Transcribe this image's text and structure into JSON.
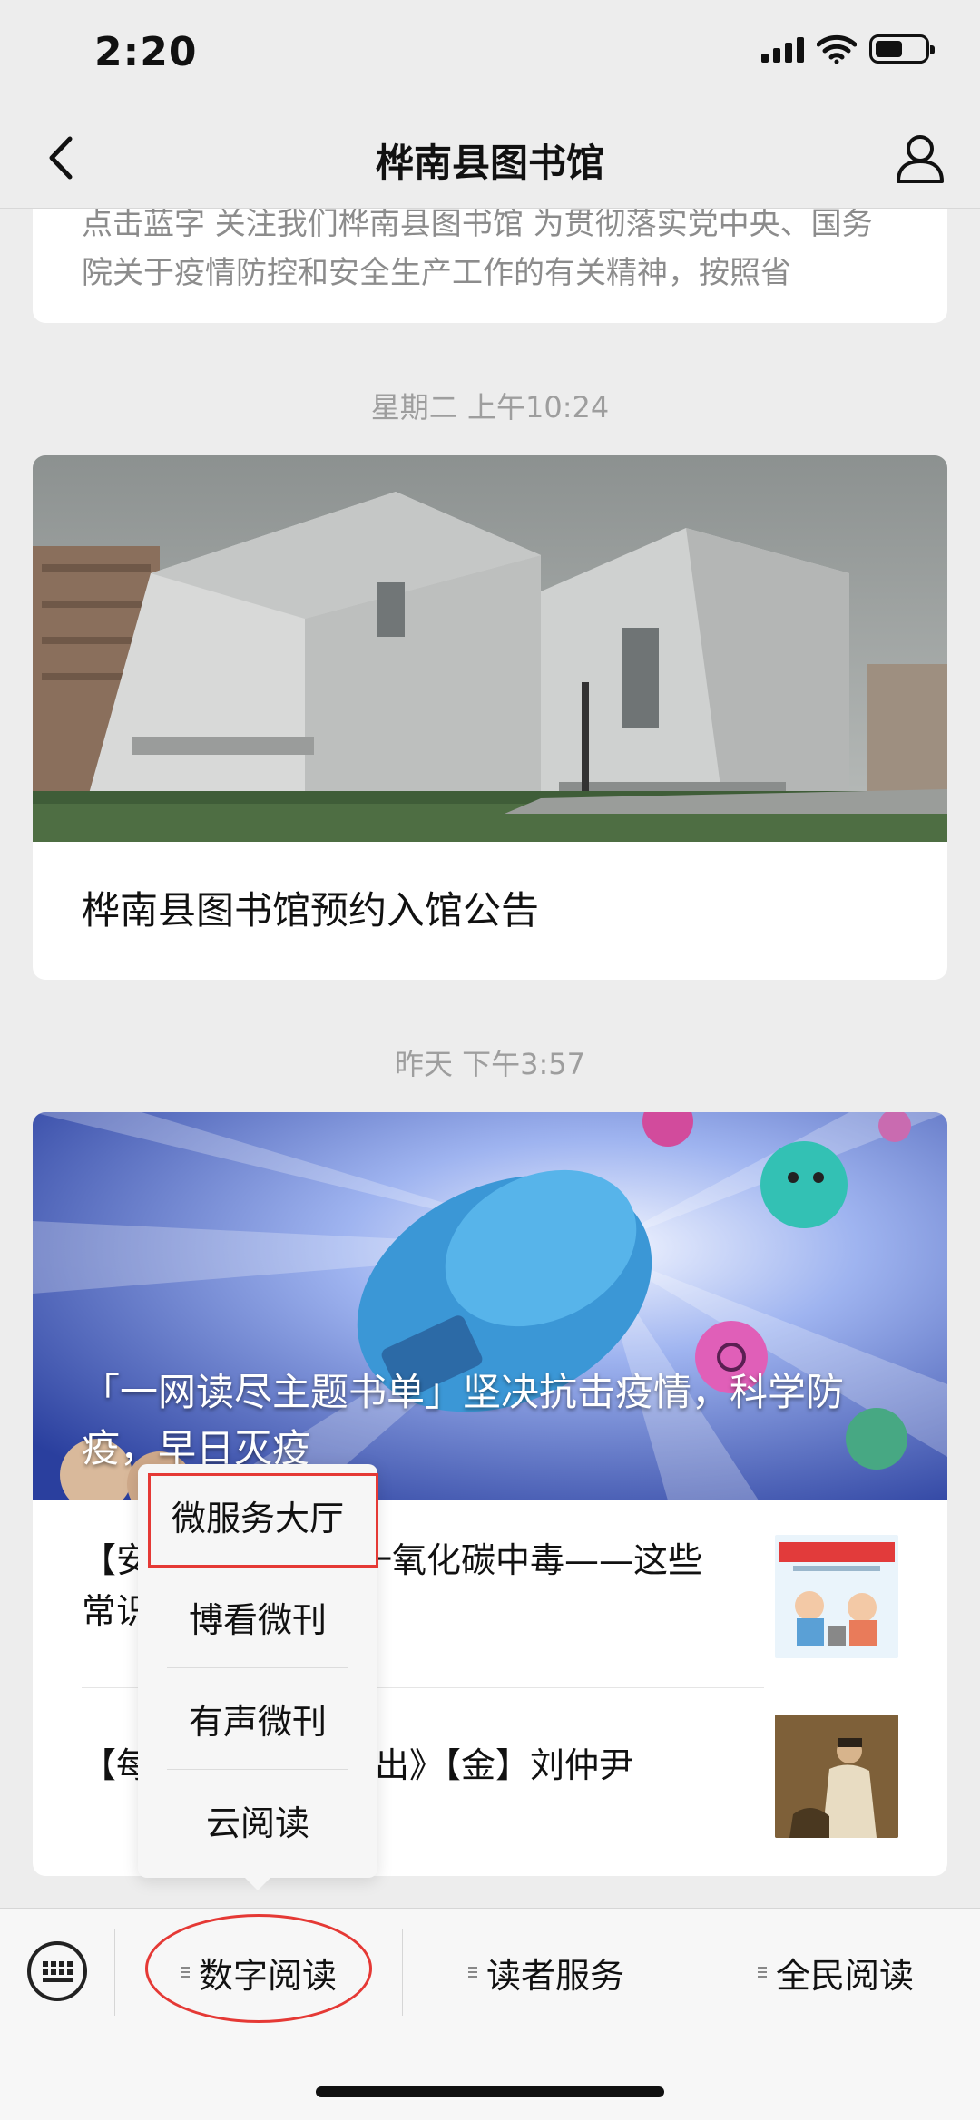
{
  "status_bar": {
    "time": "2:20",
    "icons": [
      "signal-icon",
      "wifi-icon",
      "battery-icon"
    ]
  },
  "nav": {
    "back_icon": "chevron-left-icon",
    "title": "桦南县图书馆",
    "profile_icon": "person-icon"
  },
  "feed": {
    "first_card_snippet": "点击蓝字 关注我们桦南县图书馆 为贯彻落实党中央、国务院关于疫情防控和安全生产工作的有关精神，按照省",
    "ts1": "星期二 上午10:24",
    "announcement_title": "桦南县图书馆预约入馆公告",
    "ts2": "昨天 下午3:57",
    "banner_title": "「一网读尽主题书单」坚决抗击疫情，科学防疫，早日灭疫",
    "articles": [
      {
        "title": "【安全知识】预防一氧化碳中毒——这些常识您要知道！",
        "thumb_icon": "co-poison-poster-thumb"
      },
      {
        "title": "【每日一诗】《秋日出》【金】刘仲尹",
        "thumb_icon": "painting-thumb"
      }
    ]
  },
  "popup_menu": {
    "items": [
      "微服务大厅",
      "博看微刊",
      "有声微刊",
      "云阅读"
    ]
  },
  "bottom_menu": {
    "keyboard_icon": "keyboard-icon",
    "items": [
      "数字阅读",
      "读者服务",
      "全民阅读"
    ]
  },
  "colors": {
    "background": "#ededed",
    "annotation_red": "#e53935"
  }
}
